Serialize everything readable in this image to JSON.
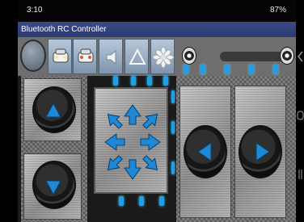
{
  "status": {
    "time": "3:10",
    "battery": "87%"
  },
  "app": {
    "title": "Bluetooth RC Controller"
  },
  "colors": {
    "accent": "#1e88d8",
    "titlebar": "#2c3a72"
  }
}
